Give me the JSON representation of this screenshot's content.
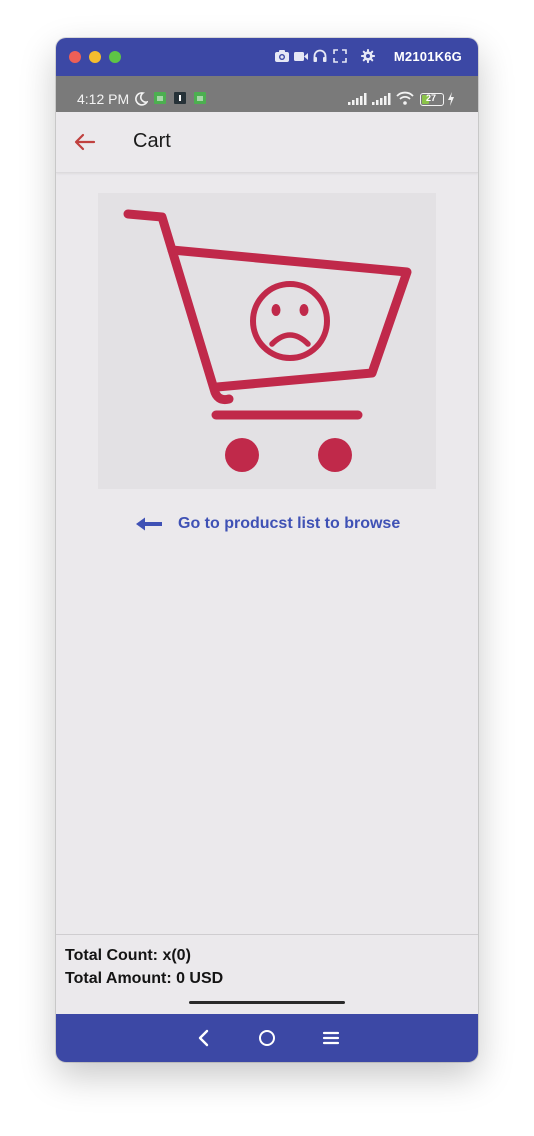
{
  "window": {
    "device_name": "M2101K6G",
    "titlebar_icons": [
      "camera-icon",
      "video-icon",
      "headphones-icon",
      "fullscreen-icon",
      "gear-icon"
    ]
  },
  "status_bar": {
    "time": "4:12 PM",
    "battery_level": "27",
    "left_icons": [
      "moon-icon",
      "android-app-icon",
      "notification-icon",
      "android-app-icon"
    ],
    "right_icons": [
      "signal-icon",
      "signal-icon",
      "wifi-icon",
      "battery-icon",
      "charging-icon"
    ]
  },
  "app_bar": {
    "title": "Cart",
    "back_icon": "back-arrow-icon"
  },
  "empty_state": {
    "image": "sad-cart-icon",
    "link_text": "Go to producst list to browse",
    "link_icon": "left-arrow-icon"
  },
  "totals": {
    "count_text": "Total Count: x(0)",
    "amount_text": "Total Amount: 0 USD"
  },
  "nav_bar": {
    "buttons": [
      "back-nav-icon",
      "home-nav-icon",
      "menu-nav-icon"
    ]
  },
  "colors": {
    "primary": "#3c48a5",
    "accent": "#c0294a",
    "link": "#3f51b5",
    "back_arrow": "#c0413f",
    "background": "#ebe9ec"
  }
}
